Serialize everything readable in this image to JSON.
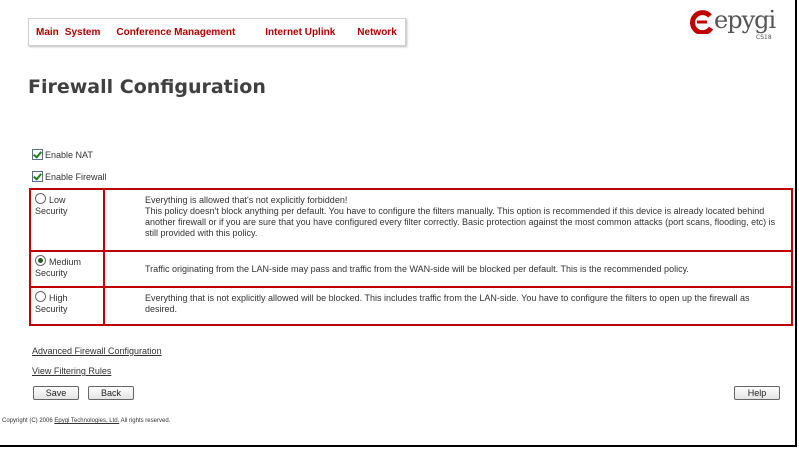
{
  "menu": [
    "Main",
    "System",
    "Conference Management",
    "Internet Uplink",
    "Network"
  ],
  "logo": {
    "text": "epygi",
    "sub": "CS18"
  },
  "page_title": "Firewall Configuration",
  "checkboxes": {
    "enable_nat": "Enable NAT",
    "enable_firewall": "Enable Firewall"
  },
  "security": [
    {
      "label": "Low Security",
      "selected": false,
      "lines": [
        "Everything is allowed that's not explicitly forbidden!",
        "This policy doesn't block anything per default. You have to configure the filters manually. This option is recommended if this device is already located behind another firewall or if you are sure that you have configured every filter correctly. Basic protection against the most common attacks (port scans, flooding, etc) is still provided with this policy."
      ]
    },
    {
      "label": "Medium Security",
      "selected": true,
      "lines": [
        "Traffic originating from the LAN-side may pass and traffic from the WAN-side will be blocked per default. This is the recommended policy."
      ]
    },
    {
      "label": "High Security",
      "selected": false,
      "lines": [
        "Everything that is not explicitly allowed will be blocked. This includes traffic from the LAN-side. You have to configure the filters to open up the firewall as desired."
      ]
    }
  ],
  "links": {
    "advanced": "Advanced Firewall Configuration",
    "filtering": "View Filtering Rules"
  },
  "buttons": {
    "save": "Save",
    "back": "Back",
    "help": "Help"
  },
  "footer": {
    "prefix": "Copyright (C) 2006 ",
    "company": "Epygi Technologies, Ltd.",
    "suffix": " All rights reserved."
  },
  "colors": {
    "menu": "#b00000",
    "border": "#c00000",
    "logo_red": "#c00000"
  }
}
